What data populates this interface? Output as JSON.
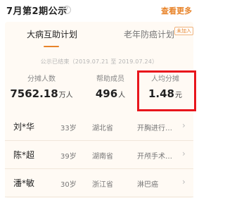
{
  "header": {
    "title": "7月第2期公示",
    "help": "?",
    "more": "查看更多"
  },
  "tabs": {
    "active": "大病互助计划",
    "inactive": "老年防癌计划",
    "badge": "未加入"
  },
  "period": "公示已结束（2019.07.21 至 2019.07.24）",
  "stats": [
    {
      "label": "分摊人数",
      "value": "7562.18",
      "unit": "万人"
    },
    {
      "label": "帮助成员",
      "value": "496",
      "unit": "人"
    },
    {
      "label": "人均分摊",
      "value": "1.48",
      "unit": "元"
    }
  ],
  "members": [
    {
      "name": "刘*华",
      "age": "33岁",
      "province": "湖北省",
      "disease": "开胸进行…"
    },
    {
      "name": "陈*超",
      "age": "39岁",
      "province": "湖南省",
      "disease": "开颅手术…"
    },
    {
      "name": "潘*敏",
      "age": "30岁",
      "province": "浙江省",
      "disease": "淋巴癌"
    }
  ],
  "colors": {
    "accent": "#e8842a",
    "highlight": "#e8161c",
    "card_bg": "#fffaf4"
  }
}
